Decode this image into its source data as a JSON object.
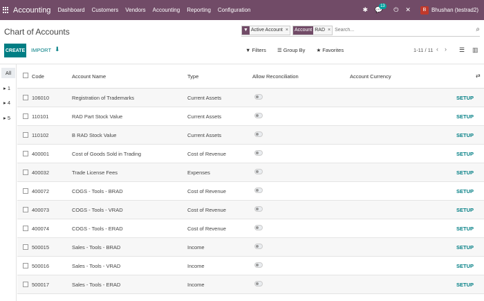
{
  "topbar": {
    "app_title": "Accounting",
    "menu": [
      "Dashboard",
      "Customers",
      "Vendors",
      "Accounting",
      "Reporting",
      "Configuration"
    ],
    "chat_count": "13",
    "avatar_letter": "B",
    "user_name": "Bhushan (testrad2)"
  },
  "control": {
    "title": "Chart of Accounts",
    "facets": [
      {
        "tag": "▼",
        "value": "Active Account"
      },
      {
        "tag": "Account",
        "value": "RAD"
      }
    ],
    "search_placeholder": "Search...",
    "create_label": "CREATE",
    "import_label": "IMPORT",
    "filters_label": "Filters",
    "groupby_label": "Group By",
    "favorites_label": "Favorites",
    "pager": "1-11 / 11"
  },
  "left_panel": [
    "All",
    "1",
    "4",
    "5"
  ],
  "table": {
    "columns": [
      "Code",
      "Account Name",
      "Type",
      "Allow Reconciliation",
      "Account Currency"
    ],
    "setup_label": "SETUP",
    "rows": [
      {
        "code": "106010",
        "name": "Registration of Trademarks",
        "type": "Current Assets"
      },
      {
        "code": "110101",
        "name": "RAD Part Stock Value",
        "type": "Current Assets"
      },
      {
        "code": "110102",
        "name": "B RAD Stock Value",
        "type": "Current Assets"
      },
      {
        "code": "400001",
        "name": "Cost of Goods Sold in Trading",
        "type": "Cost of Revenue"
      },
      {
        "code": "400032",
        "name": "Trade License Fees",
        "type": "Expenses"
      },
      {
        "code": "400072",
        "name": "COGS - Tools - BRAD",
        "type": "Cost of Revenue"
      },
      {
        "code": "400073",
        "name": "COGS - Tools - VRAD",
        "type": "Cost of Revenue"
      },
      {
        "code": "400074",
        "name": "COGS - Tools - ERAD",
        "type": "Cost of Revenue"
      },
      {
        "code": "500015",
        "name": "Sales - Tools - BRAD",
        "type": "Income"
      },
      {
        "code": "500016",
        "name": "Sales - Tools - VRAD",
        "type": "Income"
      },
      {
        "code": "500017",
        "name": "Sales - Tools - ERAD",
        "type": "Income"
      }
    ]
  }
}
